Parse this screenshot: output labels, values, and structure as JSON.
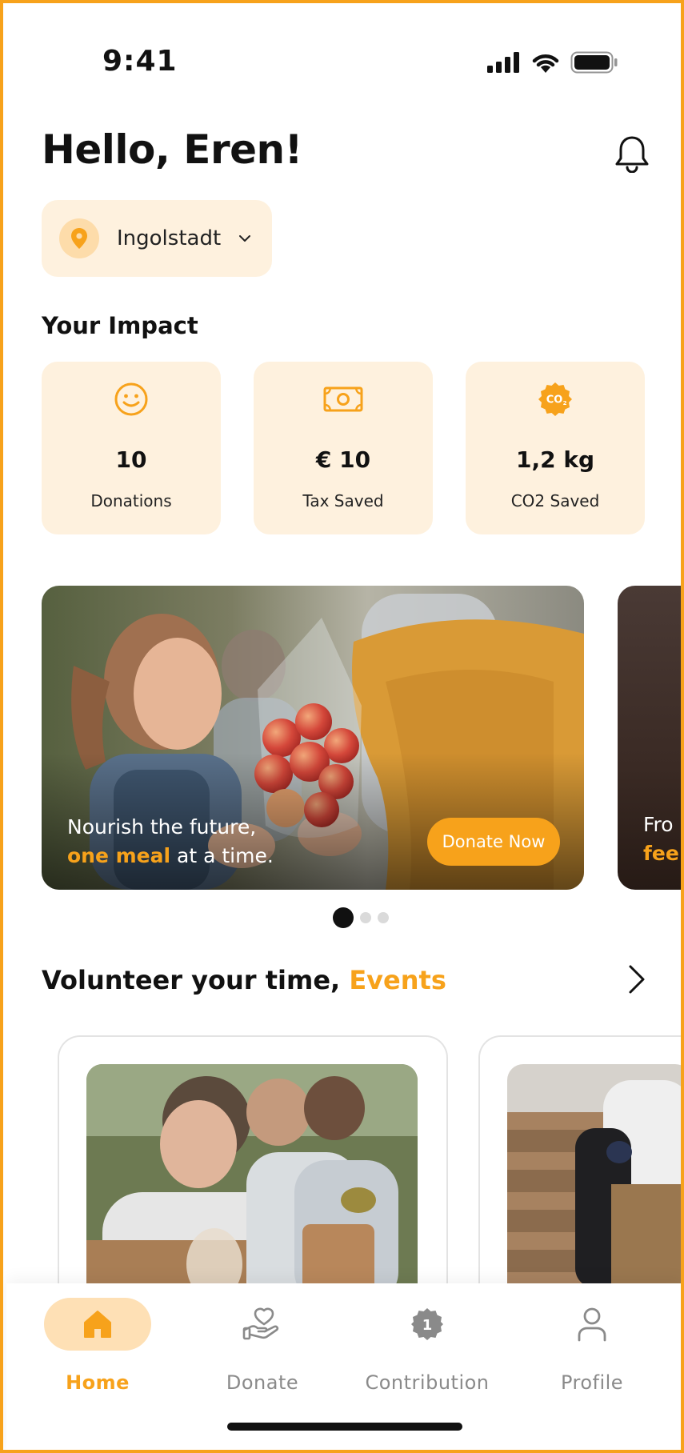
{
  "status_bar": {
    "time": "9:41"
  },
  "header": {
    "greeting": "Hello, Eren!"
  },
  "location": {
    "city": "Ingolstadt"
  },
  "impact": {
    "title": "Your Impact",
    "cards": [
      {
        "icon": "smiley-icon",
        "value": "10",
        "label": "Donations"
      },
      {
        "icon": "banknote-icon",
        "value": "€ 10",
        "label": "Tax Saved"
      },
      {
        "icon": "co2-icon",
        "value": "1,2 kg",
        "label": "CO2 Saved"
      }
    ]
  },
  "banner": {
    "line1": "Nourish the future,",
    "line2_highlight": "one meal",
    "line2_rest": " at a time.",
    "button": "Donate Now",
    "next_line1": "Fro",
    "next_line2": "fee"
  },
  "carousel": {
    "pages": 3,
    "active": 0
  },
  "events": {
    "title": "Volunteer your time, ",
    "title_highlight": "Events"
  },
  "bottom_nav": {
    "items": [
      {
        "label": "Home",
        "icon": "home-icon",
        "active": true
      },
      {
        "label": "Donate",
        "icon": "donate-hand-icon",
        "active": false
      },
      {
        "label": "Contribution",
        "icon": "badge-icon",
        "active": false
      },
      {
        "label": "Profile",
        "icon": "profile-icon",
        "active": false
      }
    ]
  },
  "colors": {
    "accent": "#F7A21B",
    "card_bg": "#FEF1DE",
    "pin_circle": "#FDDCAA",
    "nav_active_bg": "#FEE0B5"
  }
}
